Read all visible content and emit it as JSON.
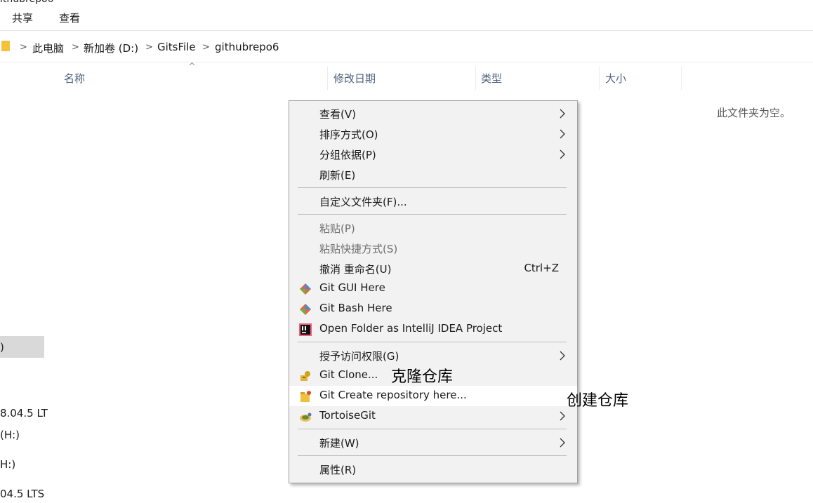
{
  "window": {
    "title": "ithubrepo6"
  },
  "ribbon": {
    "tabs": [
      "共享",
      "查看"
    ]
  },
  "address_bar": {
    "crumbs": [
      "此电脑",
      "新加卷 (D:)",
      "GitsFile",
      "githubrepo6"
    ]
  },
  "file_list": {
    "columns": [
      "名称",
      "修改日期",
      "类型",
      "大小"
    ],
    "empty_message": "此文件夹为空。"
  },
  "nav_pane": {
    "items": [
      ")",
      "8.04.5 LT",
      "(H:)",
      "H:)",
      "04.5 LTS"
    ]
  },
  "context_menu": {
    "items": [
      {
        "label": "查看(V)",
        "submenu": true
      },
      {
        "label": "排序方式(O)",
        "submenu": true
      },
      {
        "label": "分组依据(P)",
        "submenu": true
      },
      {
        "label": "刷新(E)"
      },
      {
        "label": "自定义文件夹(F)..."
      },
      {
        "label": "粘贴(P)",
        "disabled": true
      },
      {
        "label": "粘贴快捷方式(S)",
        "disabled": true
      },
      {
        "label": "撤消 重命名(U)",
        "shortcut": "Ctrl+Z"
      },
      {
        "label": "Git GUI Here",
        "icon": "git-icon"
      },
      {
        "label": "Git Bash Here",
        "icon": "git-icon"
      },
      {
        "label": "Open Folder as IntelliJ IDEA Project",
        "icon": "intellij-icon"
      },
      {
        "label": "授予访问权限(G)",
        "submenu": true
      },
      {
        "label": "Git Clone...",
        "icon": "tortoisegit-clone-icon"
      },
      {
        "label": "Git Create repository here...",
        "icon": "tortoisegit-create-icon",
        "highlighted": true
      },
      {
        "label": "TortoiseGit",
        "icon": "tortoisegit-icon",
        "submenu": true
      },
      {
        "label": "新建(W)",
        "submenu": true
      },
      {
        "label": "属性(R)"
      }
    ]
  },
  "annotations": {
    "clone": "克隆仓库",
    "create": "创建仓库"
  }
}
